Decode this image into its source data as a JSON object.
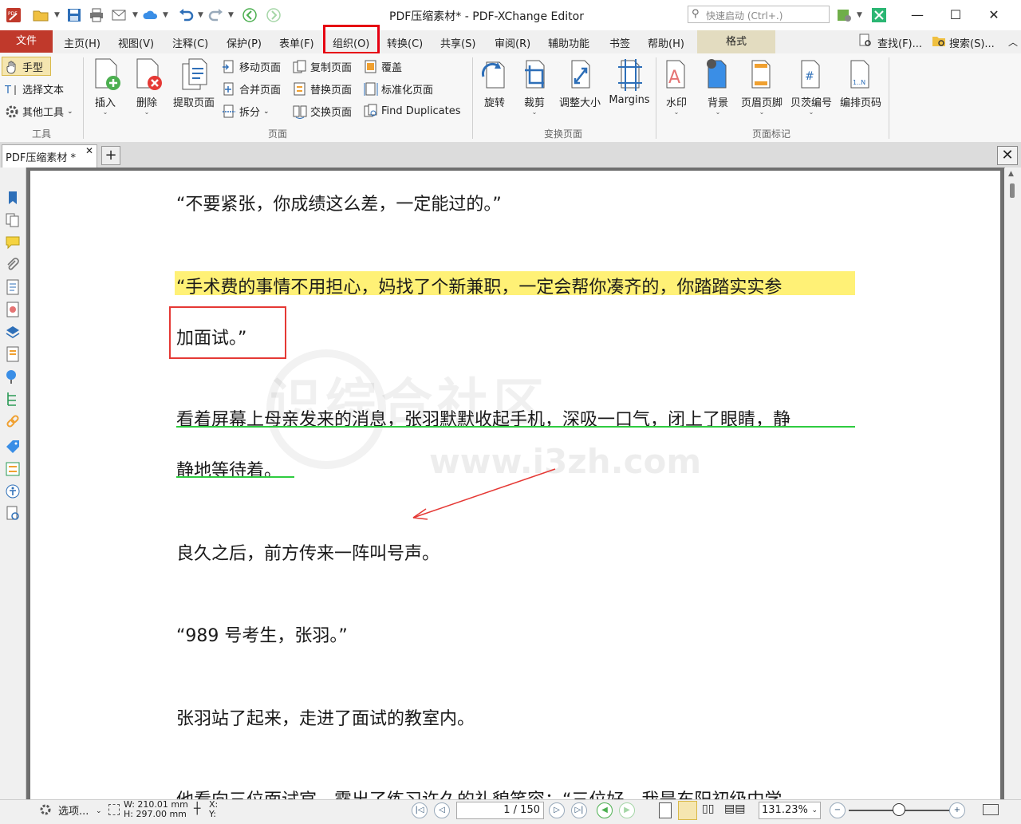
{
  "window": {
    "title": "PDF压缩素材* - PDF-XChange Editor",
    "quick_launch_placeholder": "快速启动 (Ctrl+.)"
  },
  "menu": {
    "file": "文件",
    "items": [
      "主页(H)",
      "视图(V)",
      "注释(C)",
      "保护(P)",
      "表单(F)",
      "组织(O)",
      "转换(C)",
      "共享(S)",
      "审阅(R)",
      "辅助功能",
      "书签",
      "帮助(H)"
    ],
    "format_tab": "格式",
    "find": "查找(F)...",
    "search": "搜索(S)..."
  },
  "ribbon": {
    "tools_group": {
      "label": "工具",
      "hand": "手型",
      "select_text": "选择文本",
      "other_tools": "其他工具"
    },
    "pages_group": {
      "label": "页面",
      "insert": "插入",
      "delete": "删除",
      "extract": "提取页面",
      "move": "移动页面",
      "merge": "合并页面",
      "split": "拆分",
      "copy": "复制页面",
      "replace": "替换页面",
      "swap": "交换页面",
      "cover": "覆盖",
      "normalize": "标准化页面",
      "find_duplicates": "Find Duplicates"
    },
    "transform_group": {
      "label": "变换页面",
      "rotate": "旋转",
      "crop": "裁剪",
      "resize": "调整大小",
      "margins": "Margins"
    },
    "marks_group": {
      "label": "页面标记",
      "watermark": "水印",
      "background": "背景",
      "header_footer": "页眉页脚",
      "bates": "贝茨编号",
      "numbering": "编排页码"
    }
  },
  "tab": {
    "name": "PDF压缩素材 *"
  },
  "document": {
    "lines": [
      "“不要紧张，你成绩这么差，一定能过的。”",
      "“手术费的事情不用担心，妈找了个新兼职，一定会帮你凑齐的，你踏踏实实参",
      "加面试。”",
      "看着屏幕上母亲发来的消息，张羽默默收起手机，深吸一口气，闭上了眼睛，静",
      "静地等待着。",
      "良久之后，前方传来一阵叫号声。",
      "“989 号考生，张羽。”",
      "张羽站了起来，走进了面试的教室内。",
      "他看向三位面试官，露出了练习许久的礼貌笑容：“三位好，我是东阳初级中学"
    ],
    "watermark_text": "识综合社区",
    "watermark_url": "www.i3zh.com"
  },
  "status": {
    "options": "选项...",
    "width": "W: 210.01 mm",
    "height": "H: 297.00 mm",
    "x": "X:",
    "y": "Y:",
    "page_current": "1",
    "page_total": "150",
    "zoom": "131.23%"
  },
  "colors": {
    "accent_red": "#c0392b",
    "highlight": "#fff176",
    "underline": "#2ecc40",
    "annotation_red": "#e53935"
  }
}
